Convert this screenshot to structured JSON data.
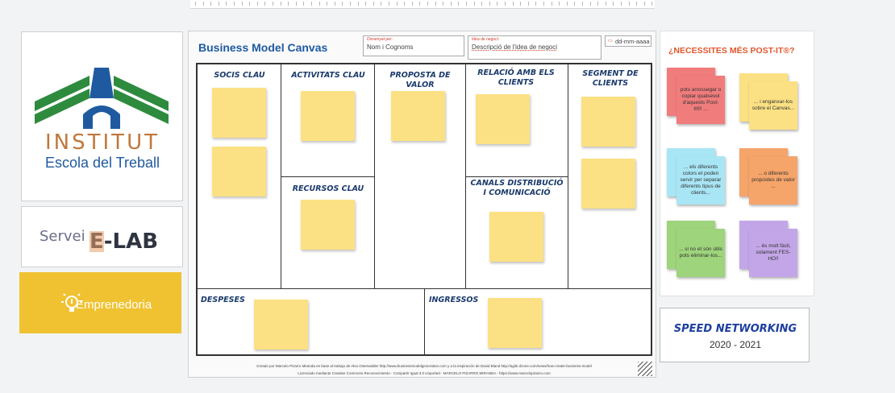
{
  "logo": {
    "title": "INSTITUT",
    "subtitle": "Escola del Treball"
  },
  "elab": {
    "prefix": "Servei",
    "brand": "E-LAB"
  },
  "emprenedoria": {
    "label": "Emprenedoria"
  },
  "canvas": {
    "title": "Business Model Canvas",
    "designed_by_label": "Dissenyat per:",
    "designed_by_value": "Nom i Cognoms",
    "idea_label": "Idea de negoci:",
    "idea_value": "Descripció de l'idea de negoci",
    "date_value": "dd-mm-aaaa",
    "sections": {
      "partners": "SOCIS CLAU",
      "activities": "ACTIVITATS CLAU",
      "value": "PROPOSTA DE VALOR",
      "relations": "RELACIÓ AMB ELS CLIENTS",
      "segments": "SEGMENT DE CLIENTS",
      "resources": "RECURSOS CLAU",
      "channels": "CANALS DISTRIBUCIÓ I COMUNICACIÓ",
      "costs": "DESPESES",
      "revenues": "INGRESSOS"
    },
    "footer_line1": "Creado por Marcelo Pizarro Miranda en base al trabajo de Alex Osterwalder http://www.businessmodelgeneration.com y a la inspiración de David Bland http://agile.dzone.com/news/how-create-business-model",
    "footer_line2": "Licenciado mediante Creative Commons Reconocimiento - Compartir Igual 3.0 Unported - MARCELO PIZARRO MIRANDA - https://www.marcelopizarro.com",
    "colors": {
      "title": "#1f5aa0",
      "note": "#fce184"
    }
  },
  "postits": {
    "title": "¿NECESSITES MÉS POST-IT®?",
    "items": [
      {
        "text": "pots arrossegar o copiar qualsevol d'aquests Post-It®! ...",
        "color": "#f07c7c"
      },
      {
        "text": "... i enganxar-los sobre el Canvas...",
        "color": "#fce184"
      },
      {
        "text": "... els diferents colors et poden servir per separar diferents tipus de clients...",
        "color": "#a9e6f5"
      },
      {
        "text": "... o diferents propostes de valor ...",
        "color": "#f5a46a"
      },
      {
        "text": "... si no et són útils pots eliminar-los...",
        "color": "#9ed47b"
      },
      {
        "text": "... és molt fàcil, solament FES-HO!!",
        "color": "#c3a6e8"
      }
    ]
  },
  "speed": {
    "title": "SPEED NETWORKING",
    "years": "2020 - 2021"
  }
}
